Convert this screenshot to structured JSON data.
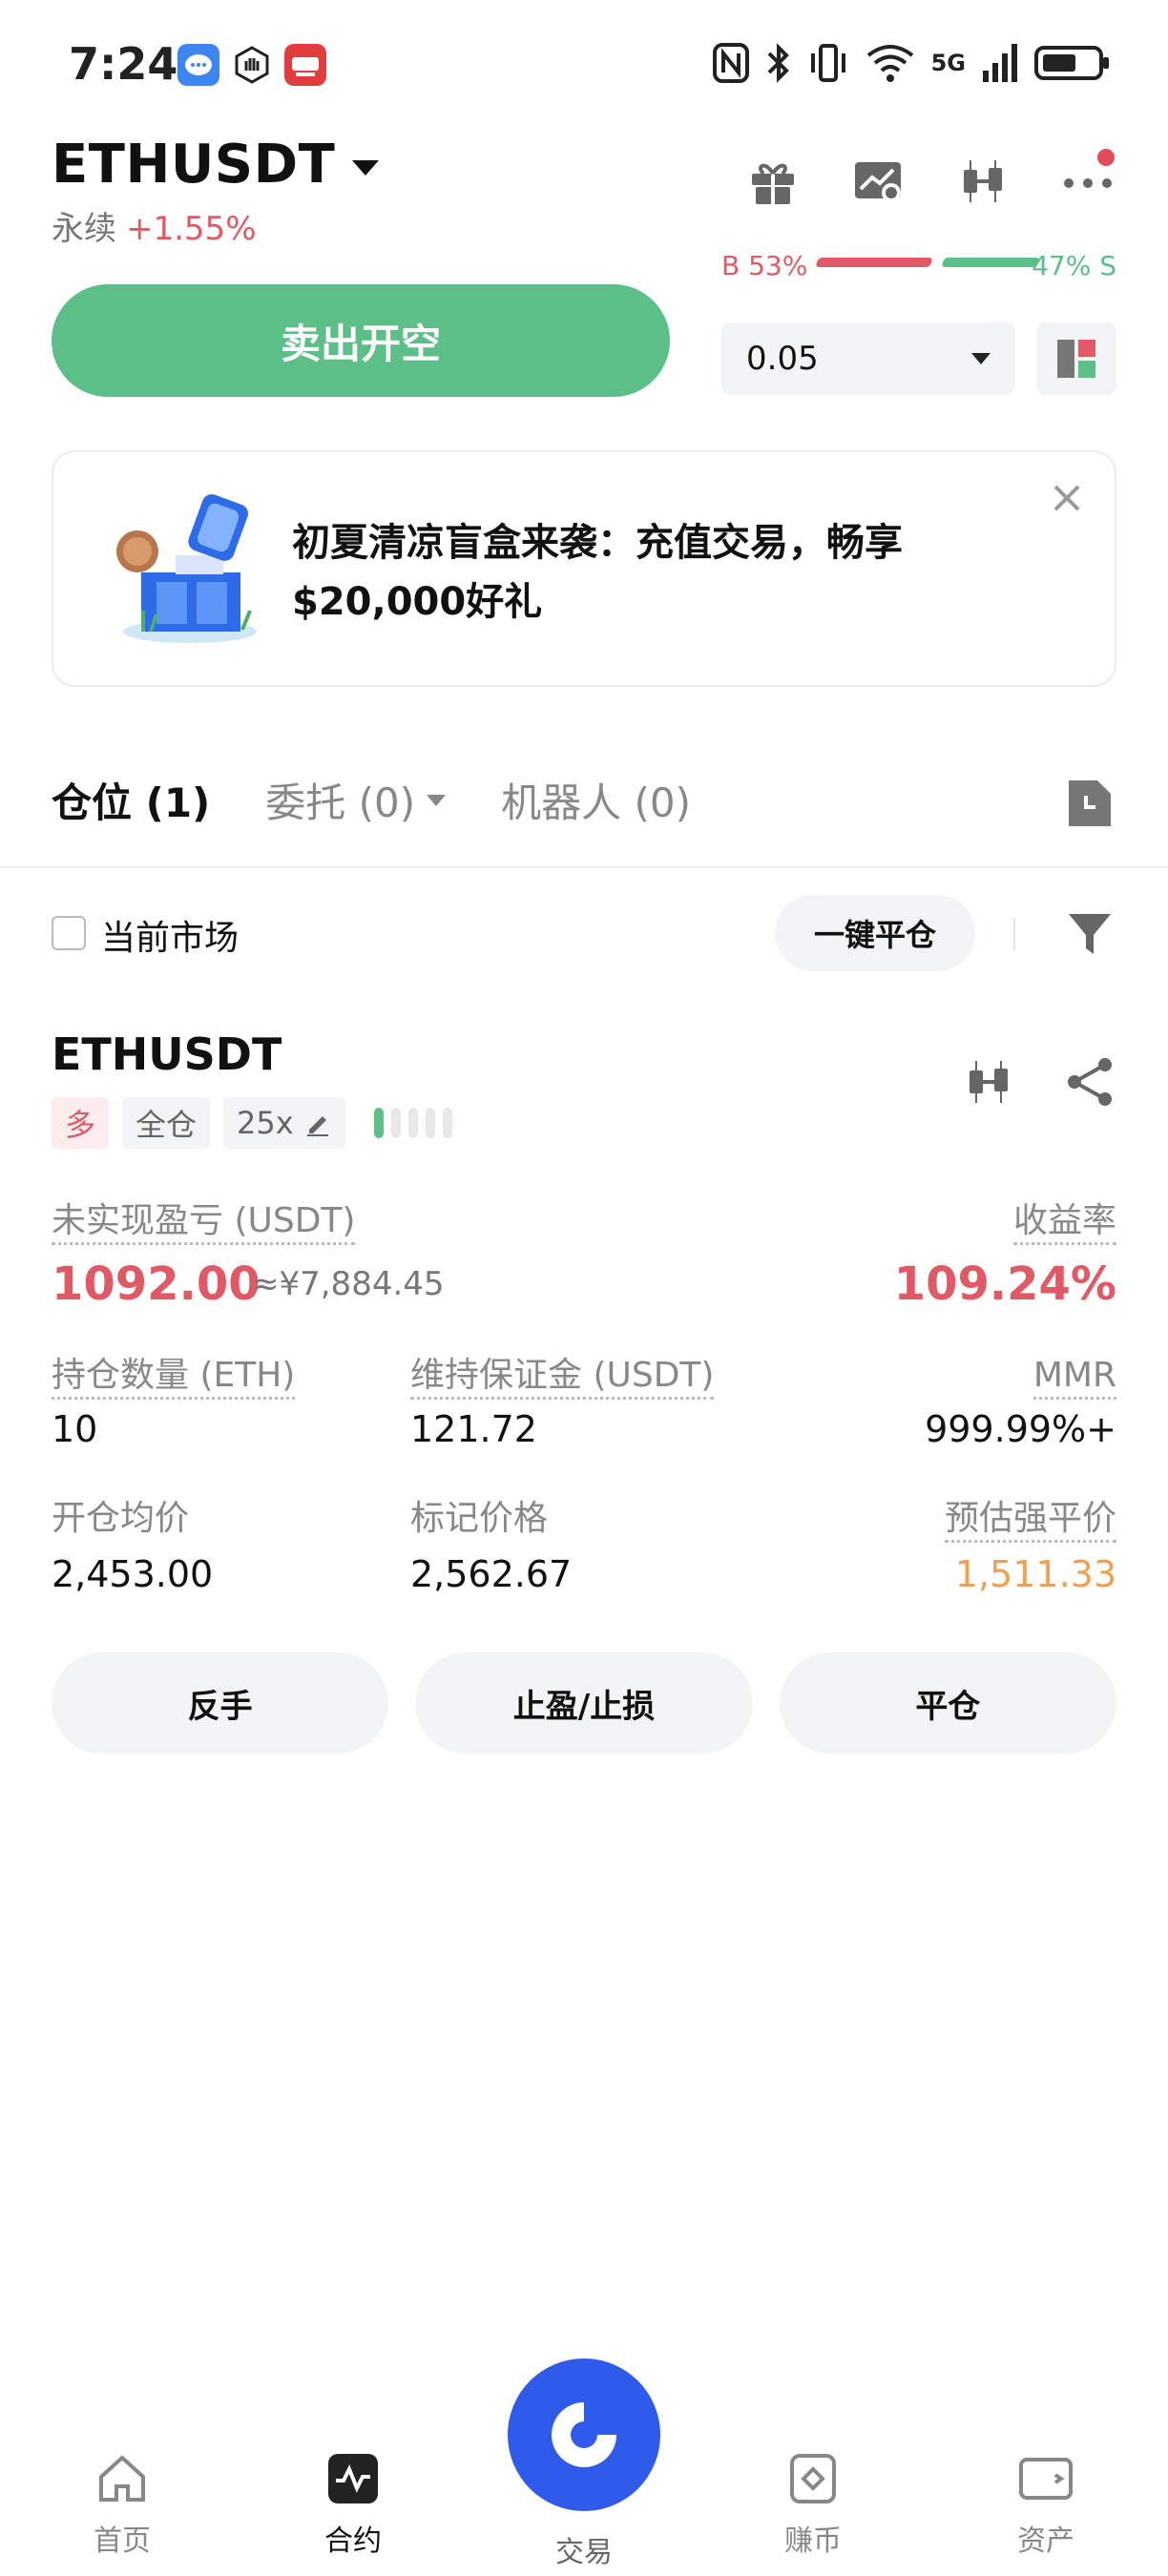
{
  "status_bar": {
    "time": "7:24",
    "network": "5G"
  },
  "header": {
    "pair": "ETHUSDT",
    "contract_type": "永续",
    "change": "+1.55%"
  },
  "ratio": {
    "buy": "B 53%",
    "sell": "47% S"
  },
  "order": {
    "sell_label": "卖出开空",
    "quantity": "0.05"
  },
  "promo": {
    "text": "初夏清凉盲盒来袭：充值交易，畅享$20,000好礼"
  },
  "tabs": [
    {
      "label": "仓位 (1)"
    },
    {
      "label": "委托 (0)"
    },
    {
      "label": "机器人 (0)"
    }
  ],
  "filter": {
    "current_market": "当前市场",
    "close_all": "一键平仓"
  },
  "position": {
    "symbol": "ETHUSDT",
    "side": "多",
    "margin_mode": "全仓",
    "leverage": "25x",
    "risk_level": 1,
    "unrealized_pnl_label": "未实现盈亏 (USDT)",
    "unrealized_pnl": "1092.00",
    "unrealized_pnl_cny": "≈¥7,884.45",
    "roe_label": "收益率",
    "roe": "109.24%",
    "size_label": "持仓数量 (ETH)",
    "size": "10",
    "maint_margin_label": "维持保证金 (USDT)",
    "maint_margin": "121.72",
    "mmr_label": "MMR",
    "mmr": "999.99%+",
    "entry_label": "开仓均价",
    "entry": "2,453.00",
    "mark_label": "标记价格",
    "mark": "2,562.67",
    "liq_label": "预估强平价",
    "liq": "1,511.33"
  },
  "actions": {
    "reverse": "反手",
    "tp_sl": "止盈/止损",
    "close": "平仓"
  },
  "nav": {
    "home": "首页",
    "contract": "合约",
    "trade": "交易",
    "earn": "赚币",
    "assets": "资产"
  },
  "colors": {
    "red": "#e05a66",
    "green": "#5cbf87",
    "orange": "#f0a050",
    "blue": "#2f5bea"
  }
}
